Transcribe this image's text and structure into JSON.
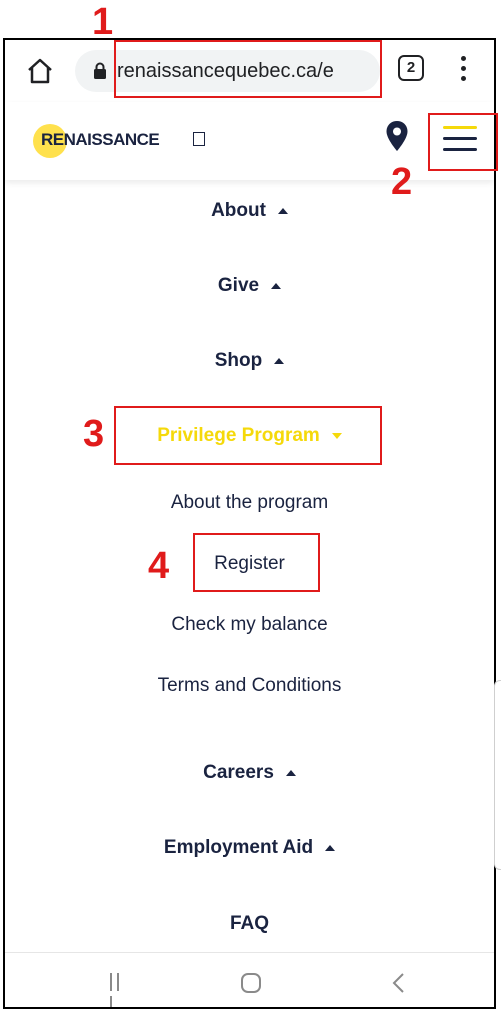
{
  "browser": {
    "url": "renaissancequebec.ca/e",
    "tab_count": "2"
  },
  "site": {
    "logo_text": "RENAISSANCE"
  },
  "menu": {
    "items": [
      {
        "label": "About"
      },
      {
        "label": "Give"
      },
      {
        "label": "Shop"
      },
      {
        "label": "Privilege Program"
      },
      {
        "label": "Careers"
      },
      {
        "label": "Employment Aid"
      },
      {
        "label": "FAQ"
      }
    ],
    "sub_items": [
      {
        "label": "About the program"
      },
      {
        "label": "Register"
      },
      {
        "label": "Check my balance"
      },
      {
        "label": "Terms and Conditions"
      }
    ]
  },
  "annotations": [
    "1",
    "2",
    "3",
    "4"
  ],
  "colors": {
    "brand_yellow": "#f5d90a",
    "brand_navy": "#1a2340",
    "annotation_red": "#e01b1b"
  }
}
